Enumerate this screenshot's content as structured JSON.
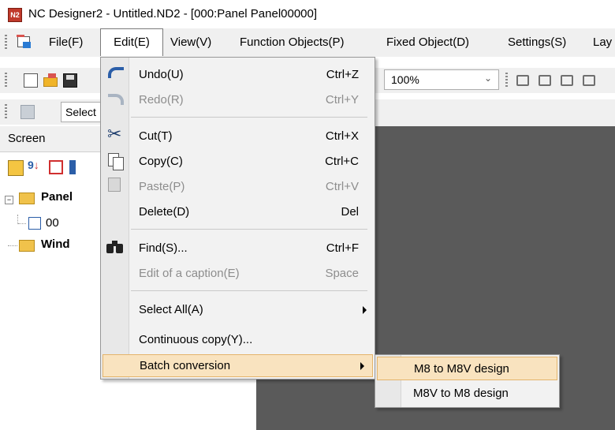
{
  "window": {
    "title": "NC Designer2 - Untitled.ND2 - [000:Panel Panel00000]",
    "app_icon_text": "N2"
  },
  "menubar": {
    "items": [
      "File(F)",
      "Edit(E)",
      "View(V)",
      "Function Objects(P)",
      "Fixed Object(D)",
      "Settings(S)",
      "Lay"
    ]
  },
  "toolbar": {
    "zoom": "100%",
    "select_label": "Select"
  },
  "screen_panel": {
    "title": "Screen",
    "tree": [
      {
        "label": "Panel",
        "bold": true
      },
      {
        "label": "00",
        "bold": false
      },
      {
        "label": "Wind",
        "bold": true
      }
    ]
  },
  "edit_menu": {
    "items": [
      {
        "label": "Undo(U)",
        "shortcut": "Ctrl+Z",
        "enabled": true,
        "icon": "undo-icon"
      },
      {
        "label": "Redo(R)",
        "shortcut": "Ctrl+Y",
        "enabled": false,
        "icon": "redo-icon"
      },
      {
        "label": "Cut(T)",
        "shortcut": "Ctrl+X",
        "enabled": true,
        "icon": "scissors-icon"
      },
      {
        "label": "Copy(C)",
        "shortcut": "Ctrl+C",
        "enabled": true,
        "icon": "copy-icon"
      },
      {
        "label": "Paste(P)",
        "shortcut": "Ctrl+V",
        "enabled": false,
        "icon": "paste-icon"
      },
      {
        "label": "Delete(D)",
        "shortcut": "Del",
        "enabled": true,
        "icon": ""
      },
      {
        "label": "Find(S)...",
        "shortcut": "Ctrl+F",
        "enabled": true,
        "icon": "binoculars-icon"
      },
      {
        "label": "Edit of a caption(E)",
        "shortcut": "Space",
        "enabled": false,
        "icon": ""
      },
      {
        "label": "Select All(A)",
        "shortcut": "",
        "enabled": true,
        "submenu": true
      },
      {
        "label": "Continuous copy(Y)...",
        "shortcut": "",
        "enabled": true
      },
      {
        "label": "Batch conversion",
        "shortcut": "",
        "enabled": true,
        "submenu": true,
        "highlighted": true
      }
    ]
  },
  "batch_submenu": {
    "items": [
      {
        "label": "M8 to M8V design",
        "highlighted": true
      },
      {
        "label": "M8V to M8 design",
        "highlighted": false
      }
    ]
  },
  "colors": {
    "highlight": "#f9e3bf",
    "canvas": "#5a5a5a",
    "menubar": "#f0f0f0"
  }
}
